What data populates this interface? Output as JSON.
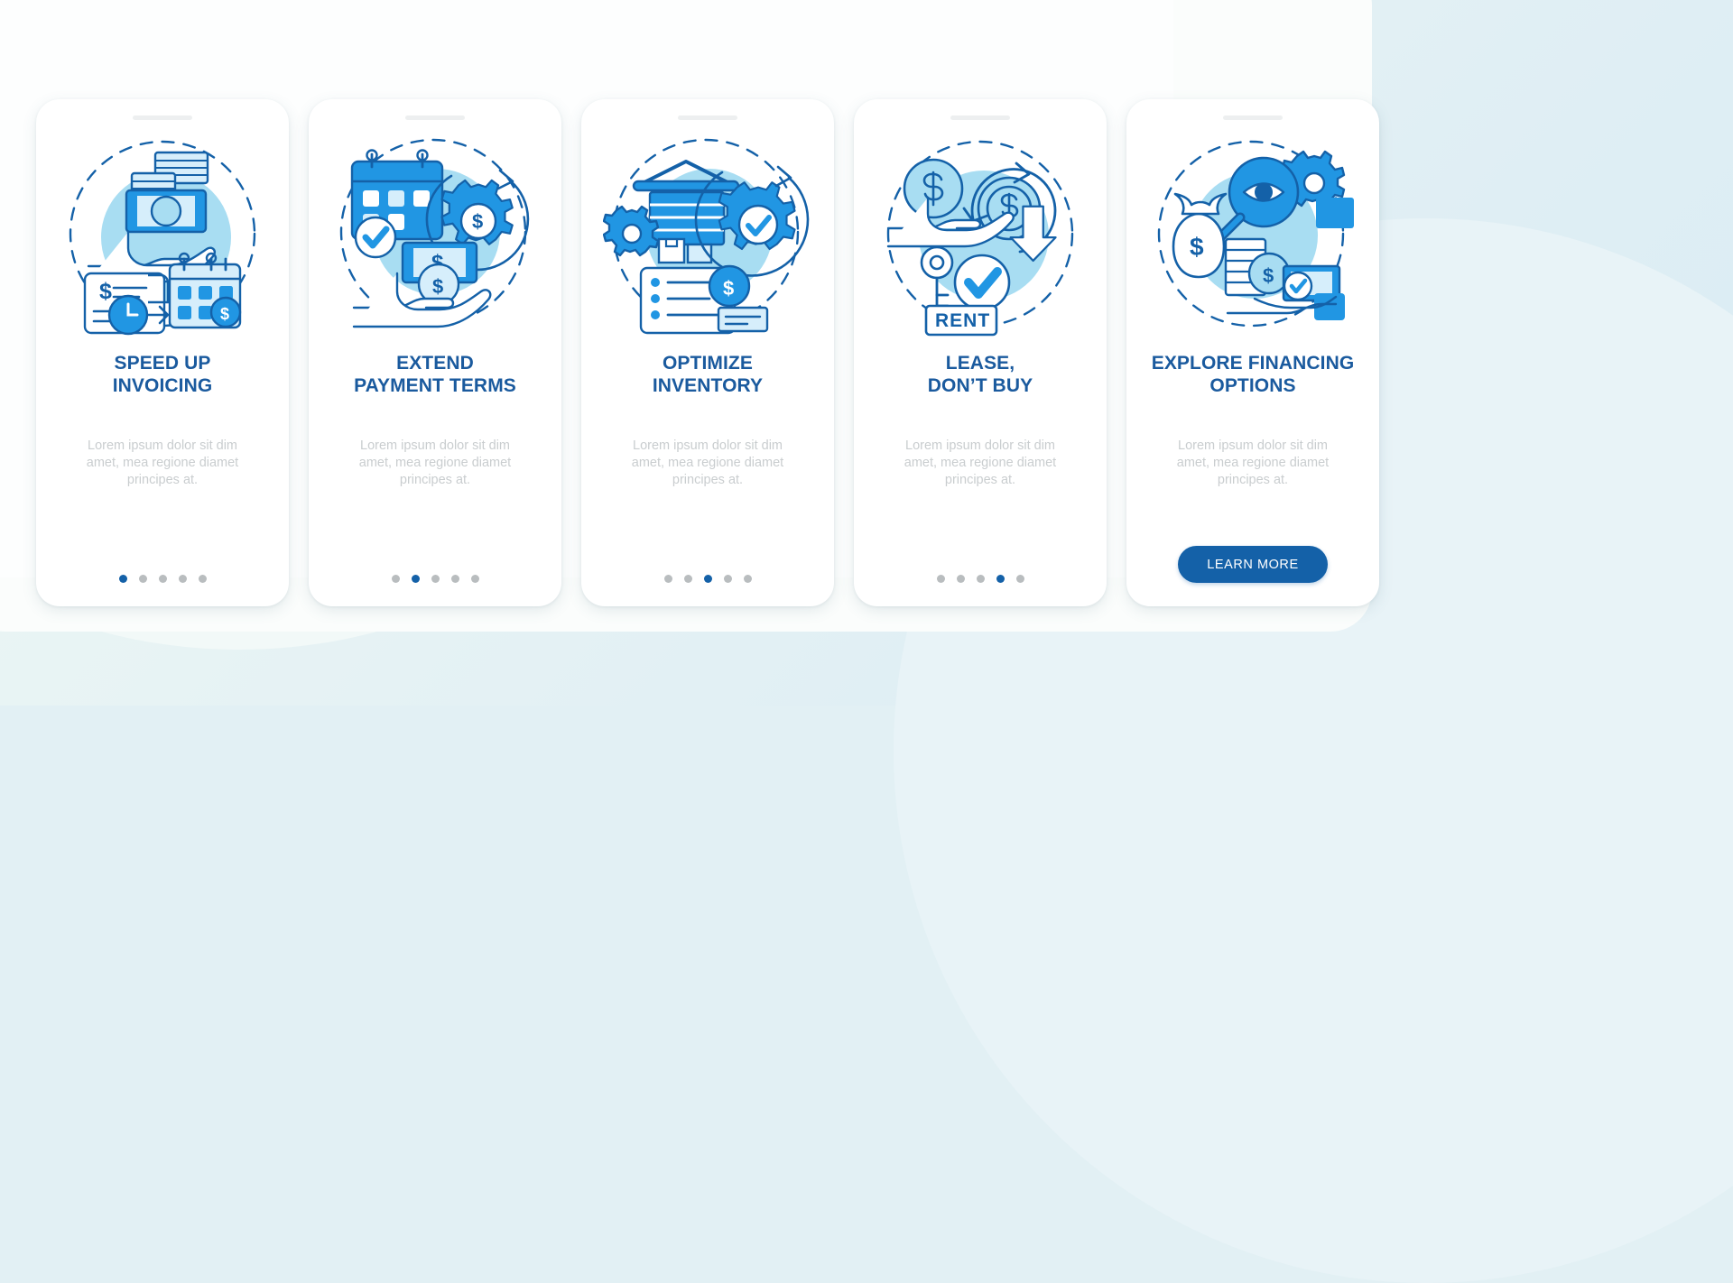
{
  "colors": {
    "accent_dark": "#1461a8",
    "accent_mid": "#2196e3",
    "accent_light": "#a8ddf2",
    "accent_pale": "#d6eefb",
    "title_blue": "#1a5a9e",
    "body_gray": "#c9cdcf",
    "dot_inactive": "#b9bdbf",
    "card_bg": "#ffffff",
    "page_bg": "#e2f0f4"
  },
  "body_text": "Lorem ipsum dolor sit dim\namet, mea regione diamet\nprincipes at.",
  "screens": [
    {
      "index": 1,
      "title": "SPEED UP\nINVOICING",
      "illustration": "invoice-hand-money-calendar-clock-icon",
      "body": "Lorem ipsum dolor sit dim\namet, mea regione diamet\nprincipes at.",
      "footer_type": "dots",
      "dots_total": 5,
      "dots_active": 1
    },
    {
      "index": 2,
      "title": "EXTEND\nPAYMENT TERMS",
      "illustration": "calendar-gear-dollar-banknote-hand-icon",
      "body": "Lorem ipsum dolor sit dim\namet, mea regione diamet\nprincipes at.",
      "footer_type": "dots",
      "dots_total": 5,
      "dots_active": 2
    },
    {
      "index": 3,
      "title": "OPTIMIZE\nINVENTORY",
      "illustration": "warehouse-gear-checkmark-checklist-icon",
      "body": "Lorem ipsum dolor sit dim\namet, mea regione diamet\nprincipes at.",
      "footer_type": "dots",
      "dots_total": 5,
      "dots_active": 3
    },
    {
      "index": 4,
      "title": "LEASE,\nDON’T BUY",
      "illustration": "rent-key-coin-hand-checkmark-icon",
      "body": "Lorem ipsum dolor sit dim\namet, mea regione diamet\nprincipes at.",
      "footer_type": "dots",
      "dots_total": 5,
      "dots_active": 4
    },
    {
      "index": 5,
      "title": "EXPLORE FINANCING\nOPTIONS",
      "illustration": "magnifier-eye-gear-moneybag-cash-hand-icon",
      "body": "Lorem ipsum dolor sit dim\namet, mea regione diamet\nprincipes at.",
      "footer_type": "button",
      "button_label": "LEARN MORE"
    }
  ]
}
